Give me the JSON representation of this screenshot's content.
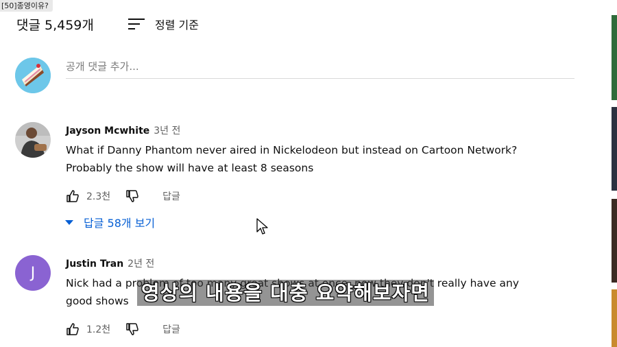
{
  "caption_tag": "[50]종영이유?",
  "header": {
    "count_label": "댓글 5,459개",
    "sort_label": "정렬 기준"
  },
  "add_comment": {
    "placeholder": "공개 댓글 추가..."
  },
  "comments": [
    {
      "author": "Jayson Mcwhite",
      "time": "3년 전",
      "text_line1": "What if Danny Phantom never aired in Nickelodeon but instead on Cartoon Network?",
      "text_line2": "Probably the show will have at least 8 seasons",
      "likes": "2.3천",
      "reply_label": "답글",
      "replies_toggle": "답글 58개 보기"
    },
    {
      "author": "Justin Tran",
      "avatar_letter": "J",
      "time": "2년 전",
      "text_line1": "Nick had a problem of too many great shows at once, now they don't really have any",
      "text_line2": "good shows",
      "likes": "1.2천",
      "reply_label": "답글"
    }
  ],
  "subtitle": "영상의 내용을 대충 요약해보자면",
  "colors": {
    "link_blue": "#065fd4",
    "avatar_purple": "#8a63d2",
    "text_secondary": "#606060"
  }
}
